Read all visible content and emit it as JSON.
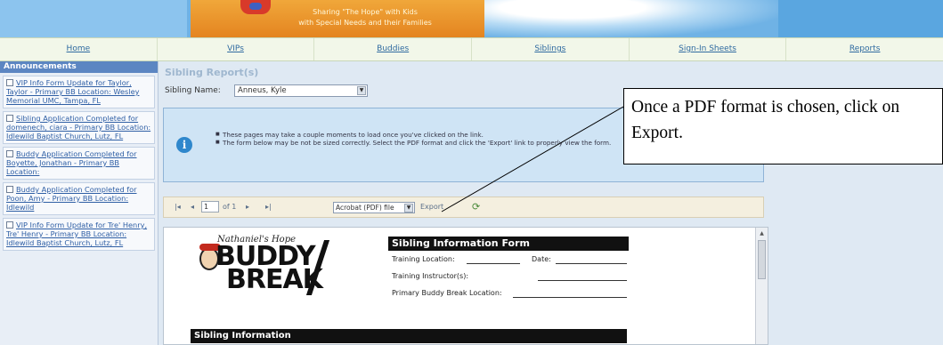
{
  "banner": {
    "tagline_line1": "Sharing \"The Hope\" with Kids",
    "tagline_line2": "with Special Needs and their Families"
  },
  "nav": {
    "items": [
      "Home",
      "VIPs",
      "Buddies",
      "Siblings",
      "Sign-In Sheets",
      "Reports"
    ]
  },
  "sidebar": {
    "header": "Announcements",
    "items": [
      "VIP Info Form Update for Taylor, Taylor - Primary BB Location: Wesley Memorial UMC, Tampa, FL",
      "Sibling Application Completed for domenech, ciara - Primary BB Location: Idlewild Baptist Church, Lutz, FL",
      "Buddy Application Completed for Boyette, Jonathan - Primary BB Location:",
      "Buddy Application Completed for Poon, Amy - Primary BB Location: Idlewild",
      "VIP Info Form Update for Tre' Henry, Tre' Henry - Primary BB Location: Idlewild Baptist Church, Lutz, FL"
    ]
  },
  "main": {
    "title": "Sibling Report(s)",
    "sibling_name_label": "Sibling Name:",
    "sibling_name_value": "Anneus, Kyle",
    "info_lines": [
      "These pages may take a couple moments to load once you've clicked on the link.",
      "The form below may be not be sized correctly. Select the PDF format and click the 'Export' link to properly view the form."
    ]
  },
  "toolbar": {
    "first": "|◂",
    "prev": "◂",
    "page_value": "1",
    "of_total": "of 1",
    "next": "▸",
    "last": "▸|",
    "format_value": "Acrobat (PDF) file",
    "export_label": "Export",
    "refresh_icon": "⟳"
  },
  "form_preview": {
    "logo_top": "Nathaniel's Hope",
    "logo_buddy": "BUDDY",
    "logo_break": "BREAK",
    "title": "Sibling Information Form",
    "training_location": "Training Location:",
    "date": "Date:",
    "training_instructor": "Training Instructor(s):",
    "primary_location": "Primary Buddy Break Location:",
    "section": "Sibling Information"
  },
  "callout": {
    "text": "Once a PDF format is chosen, click on Export."
  },
  "colors": {
    "nav_link": "#2f6aa0",
    "announcement_header": "#5c86c2",
    "info_panel": "#cfe4f5",
    "toolbar_bg": "#f4efdf"
  }
}
